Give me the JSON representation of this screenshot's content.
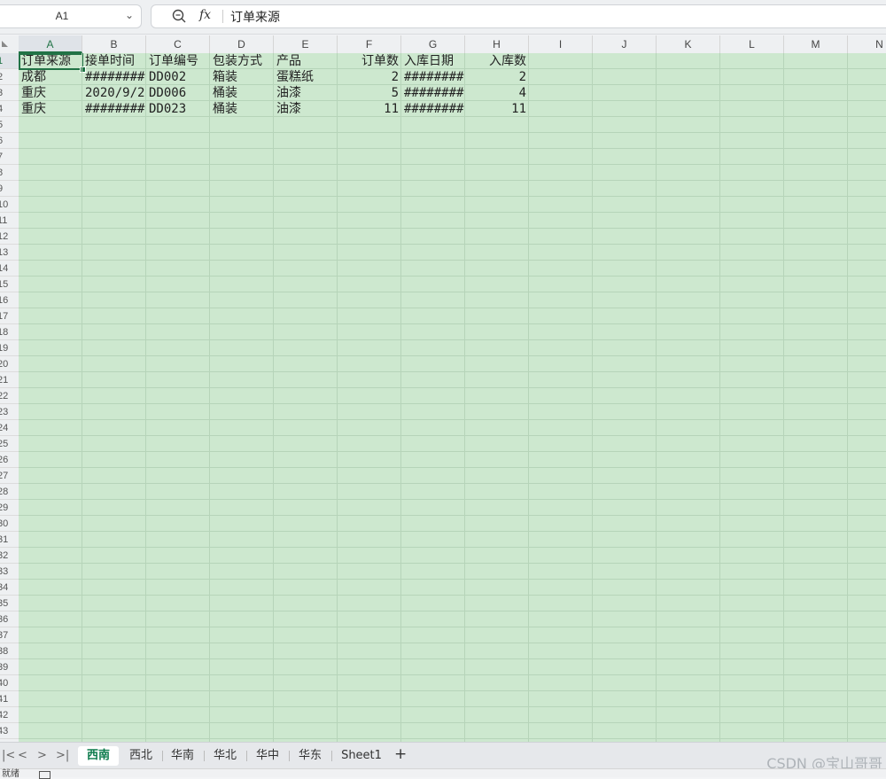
{
  "formula_bar": {
    "name_box": "A1",
    "formula_icon": "fx",
    "formula_content": "订单来源",
    "zoom_icon": "zoom-icon"
  },
  "columns": [
    "A",
    "B",
    "C",
    "D",
    "E",
    "F",
    "G",
    "H",
    "I",
    "J",
    "K",
    "L",
    "M",
    "N"
  ],
  "selected_column": "A",
  "rows": [
    "1",
    "2",
    "3",
    "4",
    "5",
    "6",
    "7",
    "8",
    "9",
    "10",
    "11",
    "12",
    "13",
    "14",
    "15",
    "16",
    "17",
    "18",
    "19",
    "20",
    "21",
    "22",
    "23",
    "24",
    "25",
    "26",
    "27",
    "28",
    "29",
    "30",
    "31",
    "32",
    "33",
    "34",
    "35",
    "36",
    "37",
    "38",
    "39",
    "40",
    "41",
    "42",
    "43"
  ],
  "selected_row": "1",
  "cells": [
    [
      "订单来源",
      "接单时间",
      "订单编号",
      "包装方式",
      "产品",
      "订单数",
      "入库日期",
      "入库数"
    ],
    [
      "成都",
      "########",
      "DD002",
      "箱装",
      "蛋糕纸",
      "2",
      "########",
      "2"
    ],
    [
      "重庆",
      "2020/9/2",
      "DD006",
      "桶装",
      "油漆",
      "5",
      "########",
      "4"
    ],
    [
      "重庆",
      "########",
      "DD023",
      "桶装",
      "油漆",
      "11",
      "########",
      "11"
    ]
  ],
  "numeric_columns": [
    5,
    7
  ],
  "sheet_tabs": [
    "西南",
    "西北",
    "华南",
    "华北",
    "华中",
    "华东",
    "Sheet1"
  ],
  "active_sheet": "西南",
  "nav_buttons": [
    "|<",
    "<",
    ">",
    ">|"
  ],
  "add_sheet_label": "+",
  "watermark": "CSDN @宝山哥哥",
  "status_text": "就绪",
  "colors": {
    "cell_background": "#cde8cf",
    "accent": "#217346",
    "active_tab_text": "#0b7a4b"
  }
}
